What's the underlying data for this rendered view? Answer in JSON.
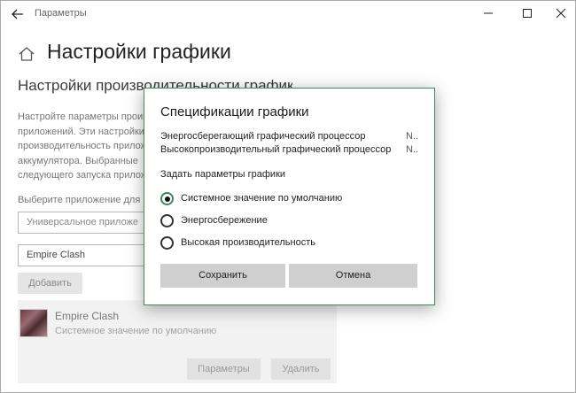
{
  "window": {
    "title": "Параметры"
  },
  "page": {
    "title": "Настройки графики",
    "section_title": "Настройки производительности графики",
    "description": [
      "Настройте параметры произ",
      "приложений. Эти настройки",
      "производительность прилож",
      "аккумулятора. Выбранные",
      "следующего запуска прилож"
    ],
    "choose_app_label": "Выберите приложение для",
    "app_type_select": "Универсальное приложе",
    "app_select": "Empire Clash",
    "add_button": "Добавить"
  },
  "app_card": {
    "name": "Empire Clash",
    "setting": "Системное значение по умолчанию",
    "params_button": "Параметры",
    "delete_button": "Удалить"
  },
  "dialog": {
    "title": "Спецификации графики",
    "gpus": [
      {
        "label": "Энергосберегающий графический процессор",
        "value": "N.."
      },
      {
        "label": "Высокопроизводительный графический процессор",
        "value": "N.."
      }
    ],
    "set_label": "Задать параметры графики",
    "options": [
      {
        "label": "Системное значение по умолчанию",
        "checked": true
      },
      {
        "label": "Энергосбережение",
        "checked": false
      },
      {
        "label": "Высокая производительность",
        "checked": false
      }
    ],
    "save_button": "Сохранить",
    "cancel_button": "Отмена"
  },
  "colors": {
    "dialog_border": "#3d8a5a",
    "button_gray": "#cfcfcf"
  }
}
